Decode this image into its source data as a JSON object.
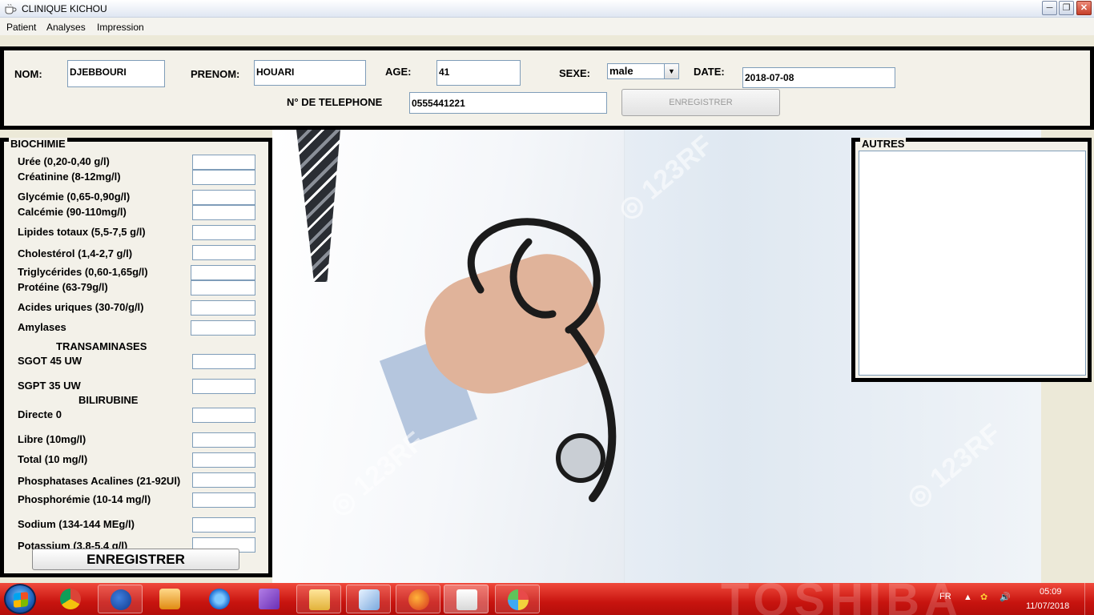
{
  "window": {
    "title": "CLINIQUE KICHOU",
    "min_icon": "minimize-icon",
    "max_icon": "maximize-icon",
    "close_icon": "close-icon"
  },
  "menu": {
    "items": [
      "Patient",
      "Analyses",
      "Impression"
    ]
  },
  "patient": {
    "nom_label": "NOM:",
    "nom_value": "DJEBBOURI",
    "prenom_label": "PRENOM:",
    "prenom_value": "HOUARI",
    "age_label": "AGE:",
    "age_value": "41",
    "sexe_label": "SEXE:",
    "sexe_value": "male",
    "date_label": "DATE:",
    "date_value": "2018-07-08",
    "tel_label": "N°  DE TELEPHONE",
    "tel_value": "0555441221",
    "save_label": "ENREGISTRER"
  },
  "biochimie": {
    "title": "BIOCHIMIE",
    "tests": [
      "Urée (0,20-0,40 g/l)",
      "Créatinine (8-12mg/l)",
      "Glycémie (0,65-0,90g/l)",
      "Calcémie (90-110mg/l)",
      "Lipides totaux (5,5-7,5 g/l)",
      "Cholestérol (1,4-2,7 g/l)",
      "Triglycérides (0,60-1,65g/l)",
      "Protéine (63-79g/l)",
      "Acides uriques (30-70/g/l)",
      "Amylases"
    ],
    "transaminases_title": "TRANSAMINASES",
    "transaminases": [
      "SGOT 45 UW",
      "SGPT 35 UW"
    ],
    "bilirubine_title": "BILIRUBINE",
    "bilirubine": [
      "Directe 0",
      "Libre (10mg/l)",
      "Total (10 mg/l)",
      "Phosphatases Acalines (21-92Ul)",
      "Phosphorémie (10-14 mg/l)",
      "Sodium (134-144 MEg/l)",
      "Potassium (3,8-5,4 g/l)"
    ],
    "save_label": "ENREGISTRER"
  },
  "autres": {
    "title": "AUTRES",
    "value": ""
  },
  "taskbar": {
    "brand": "TOSHIBA",
    "language": "FR",
    "time": "05:09",
    "date": "11/07/2018",
    "apps": [
      "chrome-icon",
      "firefox-icon",
      "media-player-icon",
      "internet-explorer-icon",
      "visual-studio-icon",
      "file-explorer-icon",
      "virtualbox-icon",
      "firefox-icon",
      "java-icon",
      "paint-icon"
    ]
  },
  "colors": {
    "taskbar": "#c8140f",
    "panel_border": "#000000",
    "panel_bg": "#f3f1e9"
  }
}
